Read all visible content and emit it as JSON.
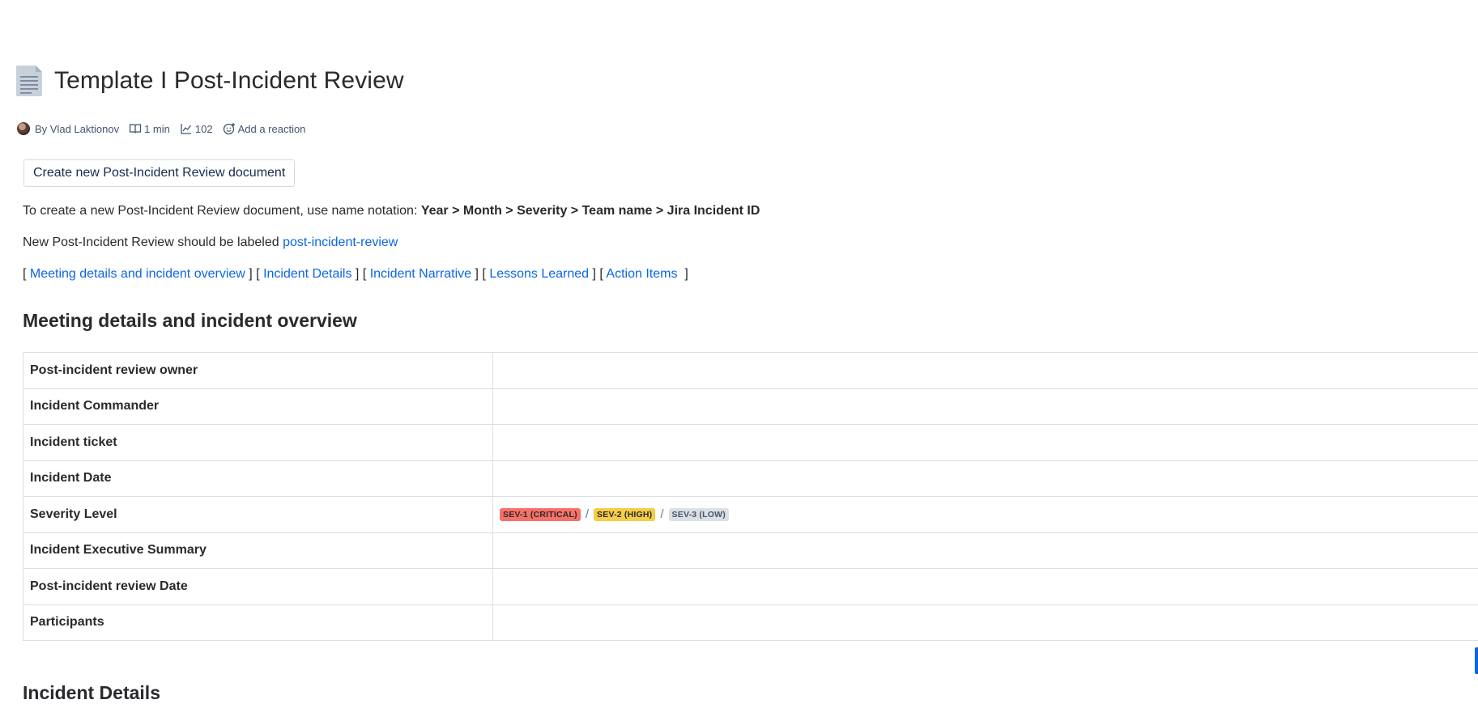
{
  "page": {
    "title": "Template I Post-Incident Review",
    "byline": {
      "author": "By Vlad Laktionov",
      "read_time": "1 min",
      "views": "102",
      "reaction": "Add a reaction"
    }
  },
  "create_button": {
    "label": "Create new Post-Incident Review document"
  },
  "intro": {
    "notation_prefix": "To create a new Post-Incident Review document, use name notation: ",
    "notation_bold": "Year > Month > Severity >  Team name > Jira Incident ID",
    "label_prefix": "New Post-Incident Review should be labeled ",
    "label_link": "post-incident-review"
  },
  "toc": {
    "open": "[ ",
    "between": " ] [ ",
    "close": "  ]",
    "items": [
      "Meeting details and incident overview",
      "Incident Details",
      "Incident Narrative",
      "Lessons Learned",
      "Action Items"
    ]
  },
  "sections": {
    "meeting": "Meeting details and incident overview",
    "details": "Incident Details"
  },
  "meeting_table": {
    "rows": [
      {
        "label": "Post-incident review owner",
        "value": ""
      },
      {
        "label": "Incident Commander",
        "value": ""
      },
      {
        "label": "Incident ticket",
        "value": ""
      },
      {
        "label": "Incident Date",
        "value": ""
      },
      {
        "label": "Severity Level",
        "value": ""
      },
      {
        "label": "Incident Executive Summary",
        "value": ""
      },
      {
        "label": "Post-incident review Date",
        "value": ""
      },
      {
        "label": "Participants",
        "value": ""
      }
    ],
    "severity_levels": [
      {
        "label": "SEV-1 (CRITICAL)",
        "bg": "#f87168",
        "color": "#292a2e"
      },
      {
        "label": "SEV-2 (HIGH)",
        "bg": "#f5cd47",
        "color": "#292a2e"
      },
      {
        "label": "SEV-3 (LOW)",
        "bg": "#dcdfe4",
        "color": "#44546f"
      }
    ],
    "severity_separator": "/"
  },
  "colors": {
    "link": "#0c66e4",
    "text": "#292a2e",
    "border": "#dcdfe4"
  },
  "icons": [
    "document-icon",
    "avatar",
    "book-icon",
    "chart-line-icon",
    "emoji-add-icon"
  ]
}
